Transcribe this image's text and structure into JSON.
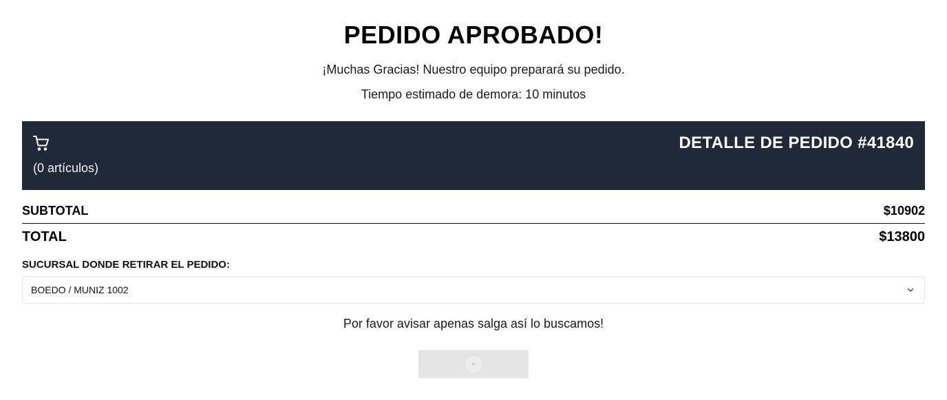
{
  "heading": {
    "title": "PEDIDO APROBADO!",
    "thanks": "¡Muchas Gracias! Nuestro equipo preparará su pedido.",
    "estimate": "Tiempo estimado de demora: 10 minutos"
  },
  "order": {
    "cart_icon": "shopping-cart-icon",
    "items_count": "(0 artículos)",
    "title": "DETALLE DE PEDIDO #41840",
    "header_color": "#1f2937"
  },
  "summary": {
    "subtotal_label": "SUBTOTAL",
    "subtotal_value": "$10902",
    "total_label": "TOTAL",
    "total_value": "$13800"
  },
  "branch": {
    "label": "SUCURSAL DONDE RETIRAR EL PEDIDO:",
    "selected": "BOEDO / MUNIZ 1002",
    "dropdown_icon": "chevron-down-icon"
  },
  "notice": "Por favor avisar apenas salga así lo buscamos!",
  "action": {
    "state": "loading",
    "icon": "spinner-icon",
    "background": "#e5e5e5"
  }
}
